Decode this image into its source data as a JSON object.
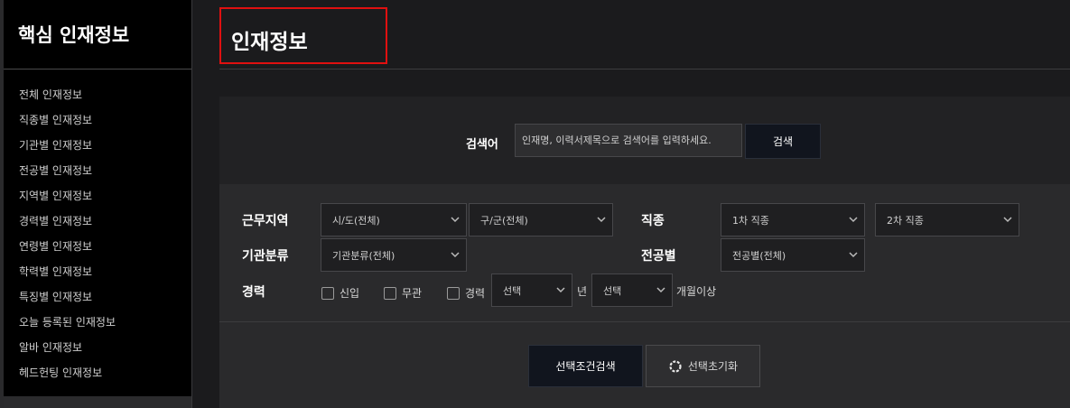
{
  "sidebar": {
    "title": "핵심 인재정보",
    "items": [
      {
        "label": "전체 인재정보"
      },
      {
        "label": "직종별 인재정보"
      },
      {
        "label": "기관별 인재정보"
      },
      {
        "label": "전공별 인재정보"
      },
      {
        "label": "지역별 인재정보"
      },
      {
        "label": "경력별 인재정보"
      },
      {
        "label": "연령별 인재정보"
      },
      {
        "label": "학력별 인재정보"
      },
      {
        "label": "특징별 인재정보"
      },
      {
        "label": "오늘 등록된 인재정보"
      },
      {
        "label": "알바 인재정보"
      },
      {
        "label": "헤드헌팅 인재정보"
      }
    ]
  },
  "main": {
    "title": "인재정보"
  },
  "search": {
    "keyword_label": "검색어",
    "placeholder": "인재명, 이력서제목으로 검색어를 입력하세요.",
    "button": "검색"
  },
  "filters": {
    "region_label": "근무지역",
    "region_city": "시/도(전체)",
    "region_district": "구/군(전체)",
    "job_label": "직종",
    "job_primary": "1차 직종",
    "job_secondary": "2차 직종",
    "org_label": "기관분류",
    "org_select": "기관분류(전체)",
    "major_label": "전공별",
    "major_select": "전공별(전체)",
    "career_label": "경력",
    "cb_new": "신입",
    "cb_any": "무관",
    "cb_career": "경력",
    "years_select": "선택",
    "years_unit": "년",
    "months_select": "선택",
    "months_unit": "개월이상"
  },
  "actions": {
    "search_conditions": "선택조건검색",
    "reset_conditions": "선택초기화"
  },
  "colors": {
    "highlight_box": "#e01010",
    "primary_button": "#11151e"
  }
}
